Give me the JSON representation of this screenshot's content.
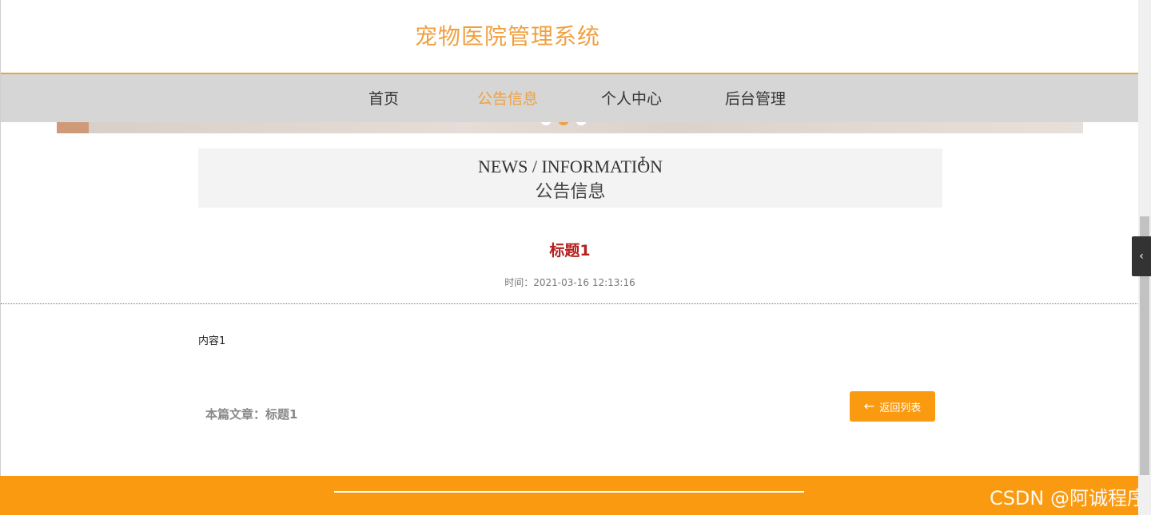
{
  "header": {
    "site_title": "宠物医院管理系统"
  },
  "nav": {
    "items": [
      {
        "label": "首页",
        "active": false
      },
      {
        "label": "公告信息",
        "active": true
      },
      {
        "label": "个人中心",
        "active": false
      },
      {
        "label": "后台管理",
        "active": false
      }
    ]
  },
  "section": {
    "title_en": "NEWS / INFORMATION",
    "title_cn": "公告信息"
  },
  "article": {
    "title": "标题1",
    "time": "时间：2021-03-16 12:13:16",
    "content": "内容1",
    "this_article": "本篇文章：标题1"
  },
  "actions": {
    "back_label": "返回列表"
  },
  "footer": {
    "watermark": "CSDN @阿诚程序"
  },
  "colors": {
    "accent": "#f0a040",
    "footer": "#fa9a10",
    "title_red": "#b51f1f",
    "nav_bg": "#d6d6d6"
  },
  "icons": {
    "back": "arrow-left-icon",
    "side_toggle": "chevron-left-icon"
  }
}
